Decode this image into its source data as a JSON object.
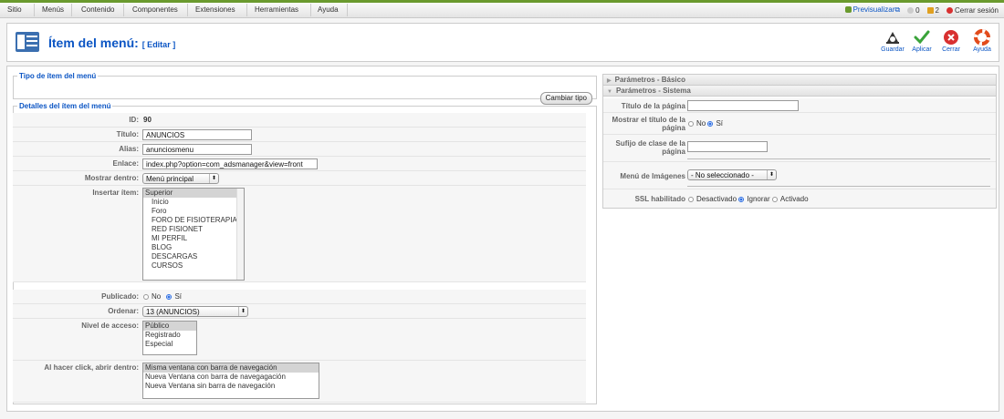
{
  "menu": {
    "items": [
      "Sitio",
      "Menús",
      "Contenido",
      "Componentes",
      "Extensiones",
      "Herramientas",
      "Ayuda"
    ]
  },
  "status": {
    "preview": "Previsualizar",
    "messages": "0",
    "users": "2",
    "logout": "Cerrar sesión"
  },
  "header": {
    "title": "Ítem del menú:",
    "subtitle": "[ Editar ]"
  },
  "toolbar": {
    "save": "Guardar",
    "apply": "Aplicar",
    "close": "Cerrar",
    "help": "Ayuda"
  },
  "type_section": {
    "legend": "Tipo de ítem del menú",
    "change_button": "Cambiar tipo"
  },
  "details": {
    "legend": "Detalles del ítem del menú",
    "id_label": "ID:",
    "id_value": "90",
    "title_label": "Título:",
    "title_value": "ANUNCIOS",
    "alias_label": "Alias:",
    "alias_value": "anunciosmenu",
    "link_label": "Enlace:",
    "link_value": "index.php?option=com_adsmanager&view=front",
    "show_in_label": "Mostrar dentro:",
    "show_in_value": "Menú principal",
    "insert_label": "Insertar ítem:",
    "insert_options": [
      "Superior",
      "Inicio",
      "Foro",
      "FORO DE FISIOTERAPIA",
      "RED FISIONET",
      "MI PERFIL",
      "BLOG",
      "DESCARGAS",
      "CURSOS"
    ],
    "published_label": "Publicado:",
    "published_no": "No",
    "published_yes": "Sí",
    "order_label": "Ordenar:",
    "order_value": "13 (ANUNCIOS)",
    "access_label": "Nivel de acceso:",
    "access_options": [
      "Público",
      "Registrado",
      "Especial"
    ],
    "click_label": "Al hacer click, abrir dentro:",
    "click_options": [
      "Misma ventana con barra de navegación",
      "Nueva Ventana con barra de navegagación",
      "Nueva Ventana sin barra de navegación"
    ]
  },
  "params": {
    "basic_header": "Parámetros - Básico",
    "system_header": "Parámetros - Sistema",
    "page_title_label": "Título de la página",
    "show_title_label": "Mostrar el título de la página",
    "show_title_no": "No",
    "show_title_yes": "Sí",
    "suffix_label": "Sufijo de clase de la página",
    "image_menu_label": "Menú de Imágenes",
    "image_menu_value": "- No seleccionado -",
    "ssl_label": "SSL habilitado",
    "ssl_off": "Desactivado",
    "ssl_ignore": "Ignorar",
    "ssl_on": "Activado"
  },
  "colors": {
    "accent": "#0b55c4",
    "top_line": "#6a9a2e",
    "apply": "#3aa33a",
    "close": "#d83030",
    "help": "#e24b1b"
  },
  "icons": [
    "preview-icon",
    "messages-icon",
    "users-icon",
    "logout-icon",
    "menu-item-icon",
    "save-icon",
    "apply-icon",
    "close-icon",
    "help-icon"
  ]
}
